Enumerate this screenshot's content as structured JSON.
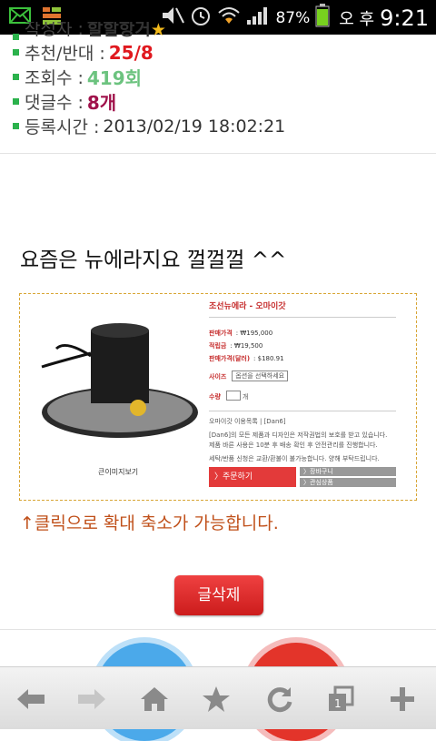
{
  "status_bar": {
    "battery": "87%",
    "ampm": "오 후",
    "time": "9:21"
  },
  "post_info": {
    "author_label": "작성자 :",
    "author_value": "할할항거",
    "votes_label": "추천/반대 :",
    "votes_value": "25/8",
    "views_label": "조회수 :",
    "views_value": "419회",
    "comments_label": "댓글수 :",
    "comments_value": "8개",
    "date_label": "등록시간 :",
    "date_value": "2013/02/19 18:02:21"
  },
  "post": {
    "title": "요즘은 뉴에라지요 껄껄껄 ^^",
    "zoom_note": "↑클릭으로 확대 축소가 가능합니다.",
    "delete_button": "글삭제"
  },
  "product": {
    "name": "조선뉴에라 - 오마이갓",
    "price_label": "판매가격",
    "price_value": ": ₩195,000",
    "reserve_label": "적립금",
    "reserve_value": ": ₩19,500",
    "usd_label": "판매가격(달러)",
    "usd_value": ": $180.91",
    "size_label": "사이즈",
    "size_option": "옵션을 선택하세요",
    "qty_label": "수량",
    "qty_unit": "개",
    "desc_title": "오마이갓 이용목록 | [Dan6]",
    "desc_1": "[Dan6]의 모든 제품과 디자인은 저작권법의 보호를 받고 있습니다.",
    "desc_2": "제품 바른 사용은 10분 후 배송 확인 후 안전관리를 진행합니다.",
    "desc_3": "세탁/반품 신청은 교환/환불이 불가능합니다. 양해 부탁드립니다.",
    "buy_button": "〉주문하기",
    "cart_button": "〉장바구니",
    "wish_button": "〉관심상품",
    "zoom_label": "큰이미지보기"
  }
}
